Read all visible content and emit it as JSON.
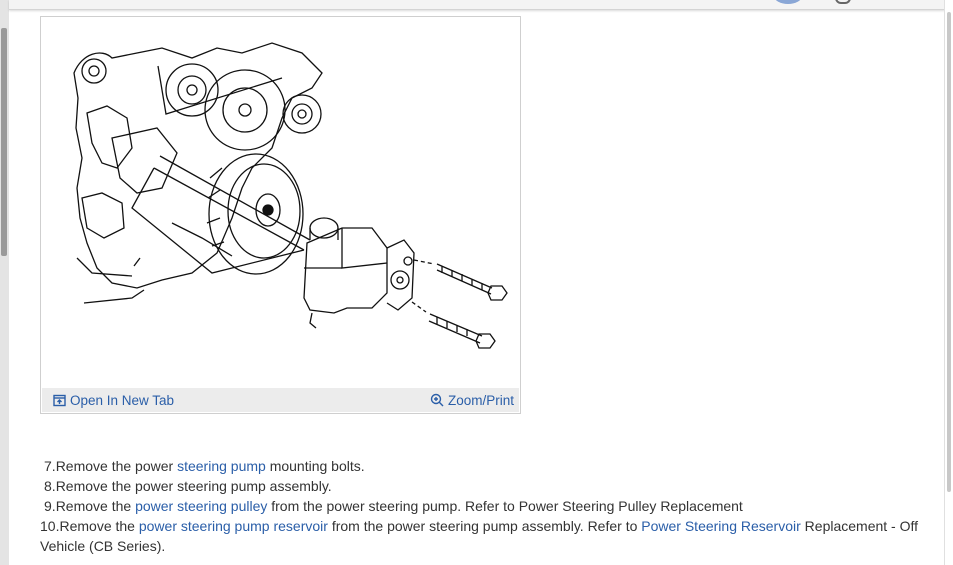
{
  "figure": {
    "open_label": "Open In New Tab",
    "zoom_label": "Zoom/Print"
  },
  "steps": [
    {
      "num": "7.",
      "parts": [
        {
          "t": "Remove the power "
        },
        {
          "t": "steering pump",
          "link": true
        },
        {
          "t": " mounting bolts."
        }
      ]
    },
    {
      "num": "8.",
      "parts": [
        {
          "t": "Remove the power steering pump assembly."
        }
      ]
    },
    {
      "num": "9.",
      "parts": [
        {
          "t": "Remove the "
        },
        {
          "t": "power steering pulley",
          "link": true
        },
        {
          "t": " from the power steering pump. Refer to Power Steering Pulley Replacement"
        }
      ]
    },
    {
      "num": "10.",
      "parts": [
        {
          "t": "Remove the "
        },
        {
          "t": "power steering pump reservoir",
          "link": true
        },
        {
          "t": " from the power steering pump assembly. Refer to "
        },
        {
          "t": "Power Steering Reservoir",
          "link": true
        },
        {
          "t": " Replacement - Off Vehicle (CB Series)."
        }
      ]
    }
  ],
  "colors": {
    "link": "#2a5ea8",
    "text": "#333333",
    "footer_bg": "#ececec"
  }
}
